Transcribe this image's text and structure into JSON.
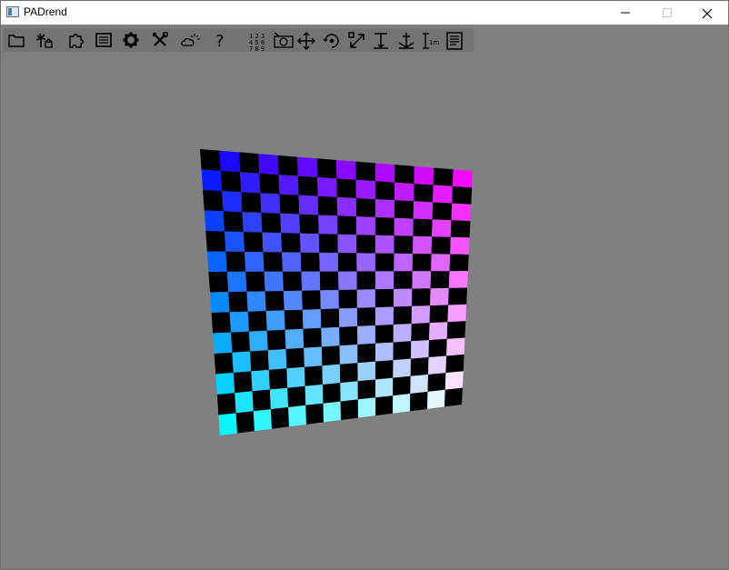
{
  "window": {
    "title": "PADrend",
    "controls": {
      "minimize": "minimize-icon",
      "maximize": "maximize-icon",
      "close": "close-icon"
    }
  },
  "toolbar": {
    "buttons": [
      {
        "id": "open",
        "icon": "folder-icon"
      },
      {
        "id": "scene-tools",
        "icon": "palm-tree-icon"
      },
      {
        "id": "plugins",
        "icon": "puzzle-piece-icon"
      },
      {
        "id": "properties",
        "icon": "list-panel-icon"
      },
      {
        "id": "settings",
        "icon": "gear-icon"
      },
      {
        "id": "tools",
        "icon": "crossed-tools-icon"
      },
      {
        "id": "effects",
        "icon": "weather-icon"
      },
      {
        "id": "help",
        "icon": "question-mark-icon"
      },
      {
        "id": "numbers",
        "icon": "number-grid-icon"
      },
      {
        "id": "camera",
        "icon": "camera-icon"
      },
      {
        "id": "move",
        "icon": "move-arrows-icon"
      },
      {
        "id": "rotate",
        "icon": "rotate-icon"
      },
      {
        "id": "scale",
        "icon": "scale-arrows-icon"
      },
      {
        "id": "snap",
        "icon": "snap-vertical-icon"
      },
      {
        "id": "anchor",
        "icon": "anchor-icon"
      },
      {
        "id": "measure",
        "icon": "measure-icon"
      },
      {
        "id": "notes",
        "icon": "notes-icon"
      }
    ],
    "number_grid": [
      "1",
      "2",
      "3",
      "4",
      "5",
      "6",
      "7",
      "8",
      "9"
    ],
    "measure_label": "1m"
  },
  "scene": {
    "background": "#808080",
    "checkerboard": {
      "rows": 14,
      "cols": 14,
      "corner_colors": {
        "top_left": "#0000ff",
        "top_right": "#ff00ff",
        "bottom_left": "#00ffff",
        "bottom_right": "#ffffff"
      },
      "dark_square_color": "#000000"
    }
  }
}
